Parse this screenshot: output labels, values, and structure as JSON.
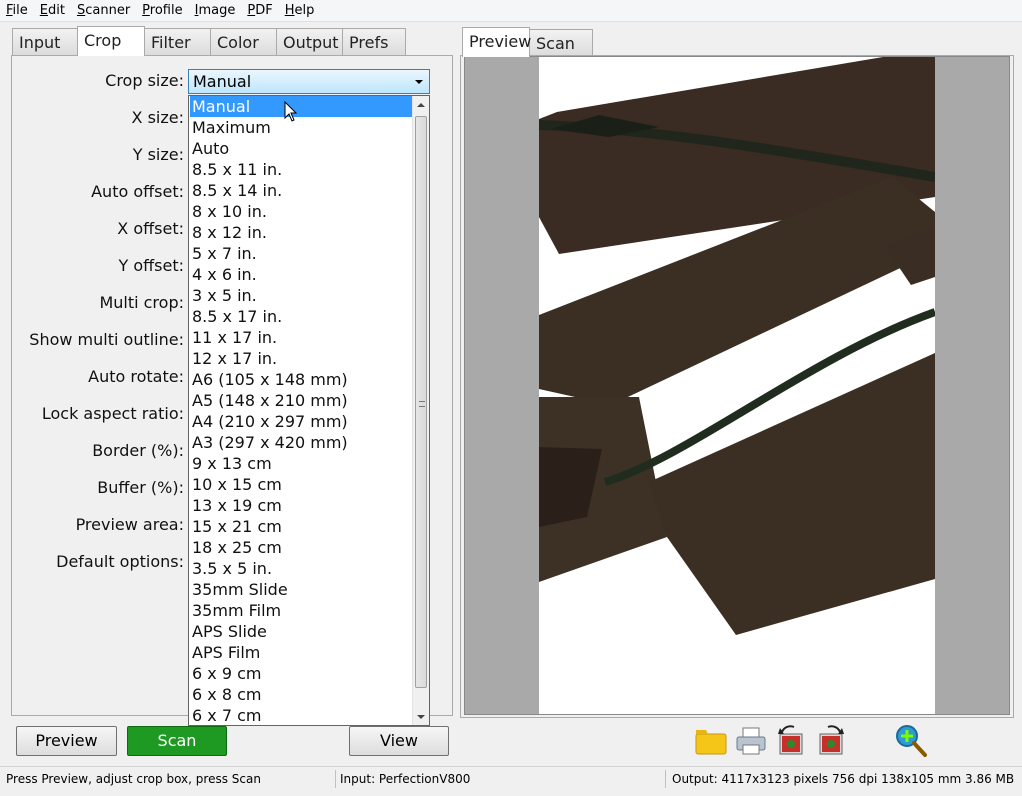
{
  "menu": [
    {
      "acc": "F",
      "rest": "ile"
    },
    {
      "acc": "E",
      "rest": "dit"
    },
    {
      "acc": "S",
      "rest": "canner"
    },
    {
      "acc": "P",
      "rest": "rofile"
    },
    {
      "acc": "I",
      "rest": "mage"
    },
    {
      "acc": "P",
      "rest": "DF"
    },
    {
      "acc": "H",
      "rest": "elp"
    }
  ],
  "left_tabs": [
    "Input",
    "Crop",
    "Filter",
    "Color",
    "Output",
    "Prefs"
  ],
  "right_tabs": [
    "Preview",
    "Scan"
  ],
  "crop": {
    "crop_size_label": "Crop size:",
    "crop_size_value": "Manual",
    "labels": {
      "x_size": "X size:",
      "y_size": "Y size:",
      "auto_offset": "Auto offset:",
      "x_offset": "X offset:",
      "y_offset": "Y offset:",
      "multi_crop": "Multi crop:",
      "show_multi_outline": "Show multi outline:",
      "auto_rotate": "Auto rotate:",
      "lock_aspect_ratio": "Lock aspect ratio:",
      "border": "Border (%):",
      "buffer": "Buffer (%):",
      "preview_area": "Preview area:",
      "default_options": "Default options:"
    }
  },
  "dropdown_items": [
    "Manual",
    "Maximum",
    "Auto",
    "8.5 x 11 in.",
    "8.5 x 14 in.",
    "8 x 10 in.",
    "8 x 12 in.",
    "5 x 7 in.",
    "4 x 6 in.",
    "3 x 5 in.",
    "8.5 x 17 in.",
    "11 x 17 in.",
    "12 x 17 in.",
    "A6 (105 x 148 mm)",
    "A5 (148 x 210 mm)",
    "A4 (210 x 297 mm)",
    "A3 (297 x 420 mm)",
    "9 x 13 cm",
    "10 x 15 cm",
    "13 x 19 cm",
    "15 x 21 cm",
    "18 x 25 cm",
    "3.5 x 5 in.",
    "35mm Slide",
    "35mm Film",
    "APS Slide",
    "APS Film",
    "6 x 9 cm",
    "6 x 8 cm",
    "6 x 7 cm"
  ],
  "dropdown_selected": "Manual",
  "buttons": {
    "preview": "Preview",
    "scan": "Scan",
    "view": "View"
  },
  "toolbar_icons": [
    "folder-icon",
    "printer-icon",
    "rotate-left-icon",
    "rotate-right-icon",
    "zoom-in-icon"
  ],
  "status": {
    "hint": "Press Preview, adjust crop box, press Scan",
    "input": "Input: PerfectionV800",
    "output": "Output: 4117x3123 pixels 756 dpi 138x105 mm 3.86 MB"
  },
  "colors": {
    "selection": "#3399ff",
    "scan_button": "#1e9a22"
  }
}
